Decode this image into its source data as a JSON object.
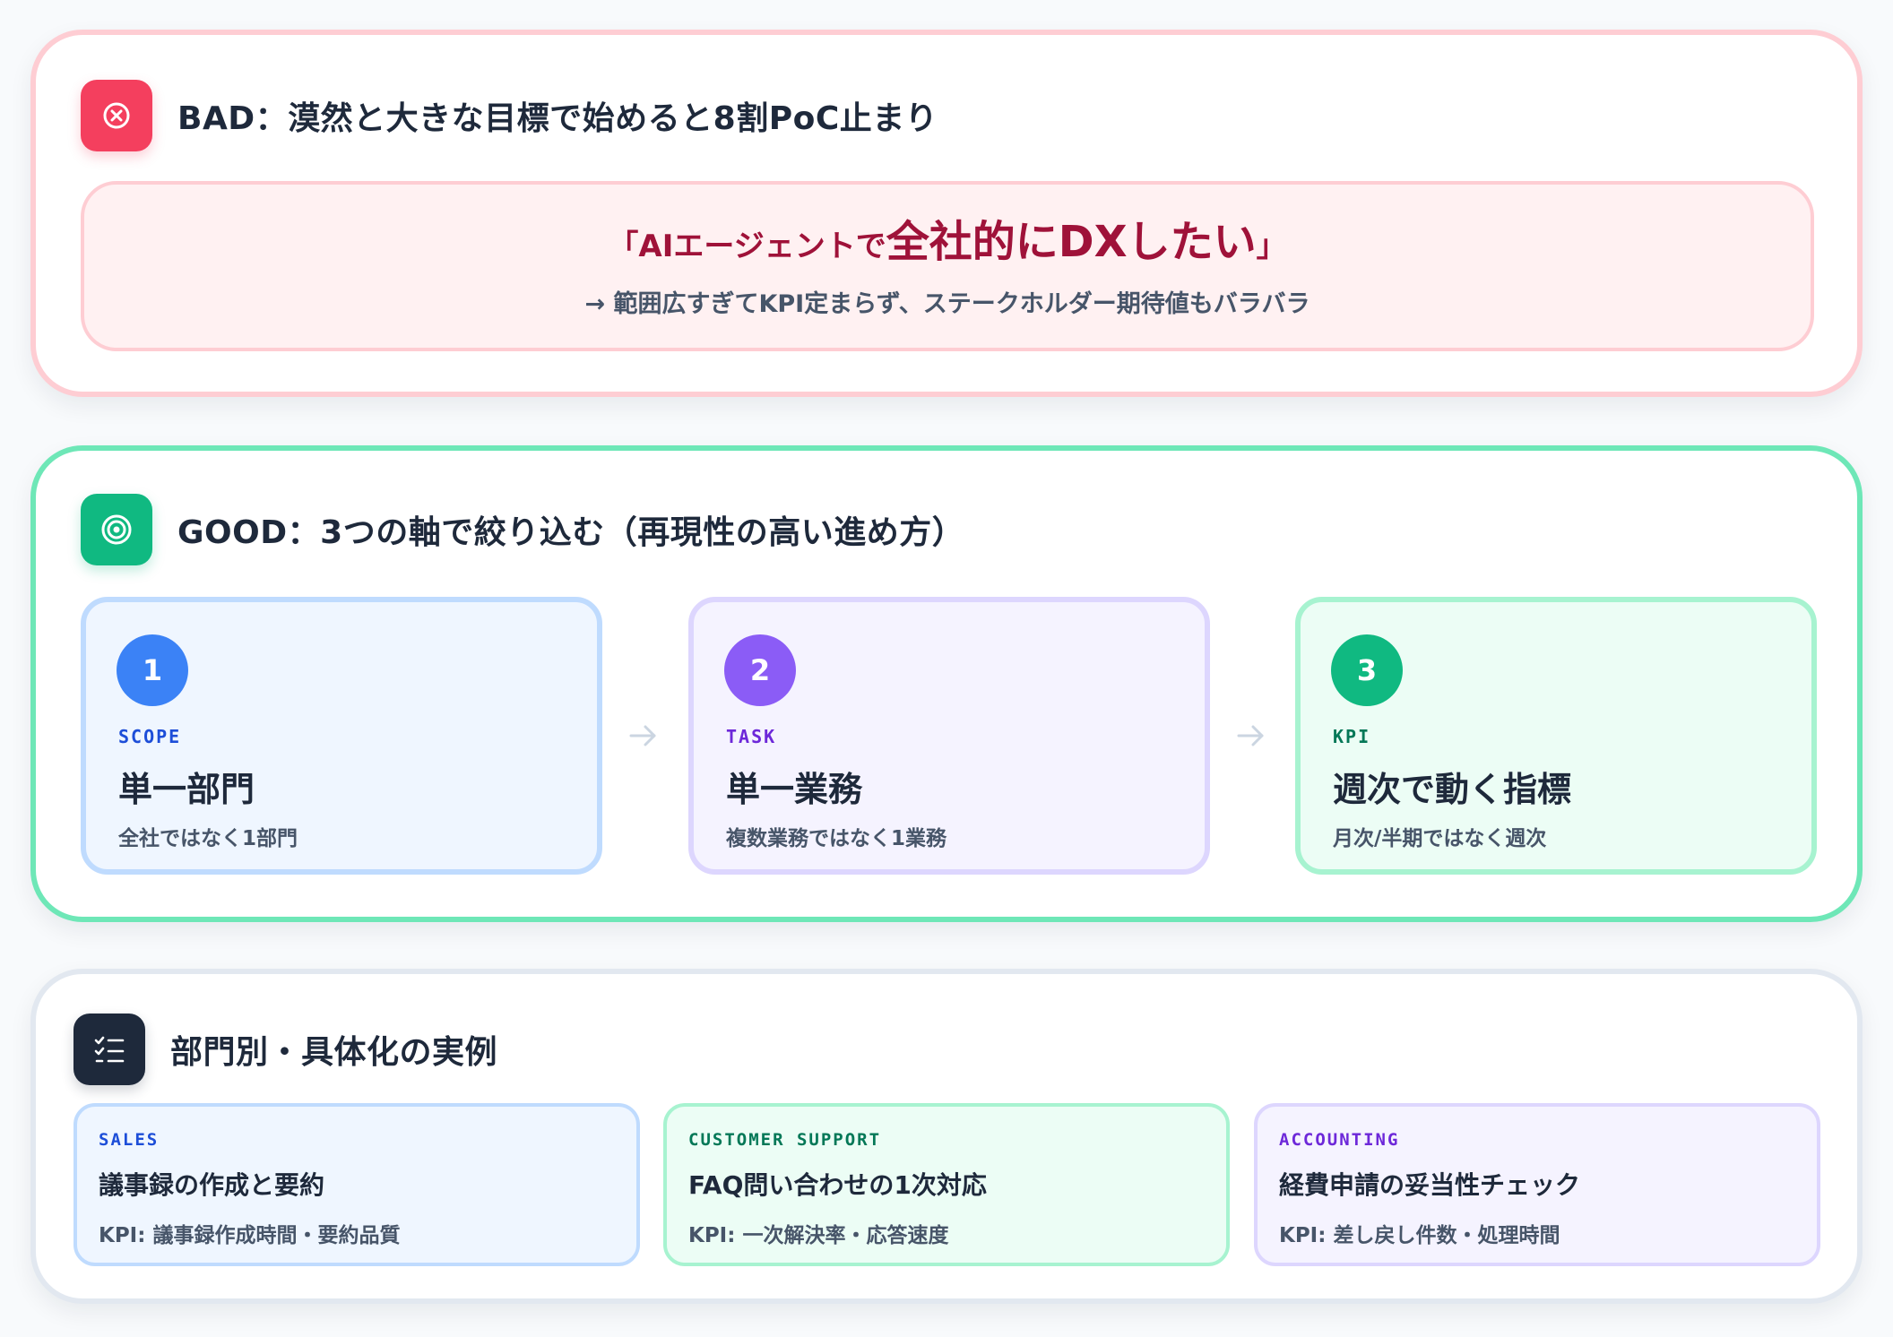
{
  "bad": {
    "title": "BAD：漠然と大きな目標で始めると8割PoC止まり",
    "icon": "x-circle-icon",
    "quote_prefix": "「AIエージェントで",
    "quote_emphasis": "全社的にDXしたい",
    "quote_suffix": "」",
    "subtext": "→ 範囲広すぎてKPI定まらず、ステークホルダー期待値もバラバラ"
  },
  "good": {
    "title": "GOOD：3つの軸で絞り込む（再現性の高い進め方）",
    "icon": "target-icon",
    "steps": [
      {
        "number": "1",
        "tag": "SCOPE",
        "title": "単一部門",
        "desc": "全社ではなく1部門"
      },
      {
        "number": "2",
        "tag": "TASK",
        "title": "単一業務",
        "desc": "複数業務ではなく1業務"
      },
      {
        "number": "3",
        "tag": "KPI",
        "title": "週次で動く指標",
        "desc": "月次/半期ではなく週次"
      }
    ]
  },
  "examples": {
    "title": "部門別・具体化の実例",
    "icon": "checklist-icon",
    "items": [
      {
        "tag": "SALES",
        "title": "議事録の作成と要約",
        "kpi": "KPI: 議事録作成時間・要約品質"
      },
      {
        "tag": "CUSTOMER SUPPORT",
        "title": "FAQ問い合わせの1次対応",
        "kpi": "KPI: 一次解決率・応答速度"
      },
      {
        "tag": "ACCOUNTING",
        "title": "経費申請の妥当性チェック",
        "kpi": "KPI: 差し戻し件数・処理時間"
      }
    ]
  },
  "colors": {
    "bad_accent": "#f43f5e",
    "good_accent": "#10b981",
    "scope": "#3b82f6",
    "task": "#8b5cf6",
    "kpi": "#10b981",
    "dark": "#1e293b"
  }
}
